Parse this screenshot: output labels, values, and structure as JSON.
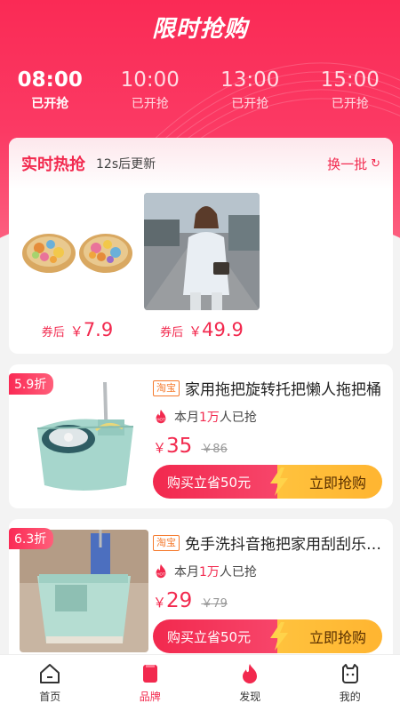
{
  "header": {
    "title": "限时抢购"
  },
  "time_slots": [
    {
      "time": "08:00",
      "status": "已开抢",
      "active": true
    },
    {
      "time": "10:00",
      "status": "已开抢",
      "active": false
    },
    {
      "time": "13:00",
      "status": "已开抢",
      "active": false
    },
    {
      "time": "15:00",
      "status": "已开抢",
      "active": false
    }
  ],
  "hot": {
    "title": "实时热抢",
    "subtitle": "12s后更新",
    "refresh_label": "换一批",
    "refresh_icon": "↻",
    "items": [
      {
        "tag": "券后",
        "currency": "￥",
        "price": "7.9"
      },
      {
        "tag": "券后",
        "currency": "￥",
        "price": "49.9"
      }
    ]
  },
  "products": [
    {
      "discount": "5.9折",
      "source": "淘宝",
      "title": "家用拖把旋转托把懒人拖把桶",
      "sales_prefix": "本月",
      "sales_count": "1万",
      "sales_suffix": "人已抢",
      "currency": "￥",
      "price": "35",
      "original_price": "￥86",
      "save_label": "购买立省50元",
      "buy_label": "立即抢购"
    },
    {
      "discount": "6.3折",
      "source": "淘宝",
      "title": "免手洗抖音拖把家用刮刮乐平板",
      "sales_prefix": "本月",
      "sales_count": "1万",
      "sales_suffix": "人已抢",
      "currency": "￥",
      "price": "29",
      "original_price": "￥79",
      "save_label": "购买立省50元",
      "buy_label": "立即抢购"
    }
  ],
  "tabbar": [
    {
      "label": "首页",
      "icon": "home-icon",
      "active": false
    },
    {
      "label": "品牌",
      "icon": "brand-icon",
      "active": true
    },
    {
      "label": "发现",
      "icon": "flame-icon",
      "active": false
    },
    {
      "label": "我的",
      "icon": "profile-icon",
      "active": false
    }
  ],
  "colors": {
    "accent": "#f2294e",
    "gold": "#ffbe3a",
    "taobao": "#f57a2d"
  }
}
